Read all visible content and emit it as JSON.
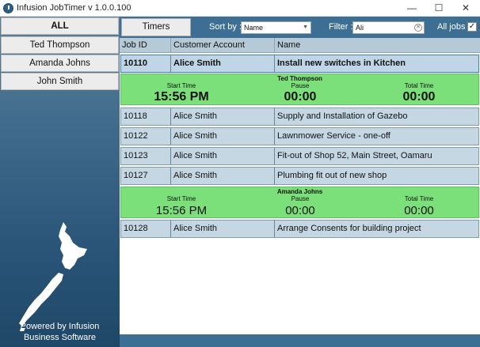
{
  "window": {
    "title": "Infusion JobTimer v 1.0.0.100",
    "controls": {
      "minimize": "—",
      "maximize": "☐",
      "close": "✕"
    }
  },
  "sidebar": {
    "items": [
      {
        "label": "ALL"
      },
      {
        "label": "Ted Thompson"
      },
      {
        "label": "Amanda Johns"
      },
      {
        "label": "John Smith"
      }
    ],
    "footer_line1": "Powered by Infusion",
    "footer_line2": "Business Software"
  },
  "toolbar": {
    "tab_label": "Timers",
    "sort_label": "Sort by :",
    "sort_value": "Name",
    "filter_label": "Filter :",
    "filter_value": "Ali",
    "all_jobs_label": "All jobs :",
    "all_jobs_checked": true
  },
  "grid": {
    "columns": [
      "Job ID",
      "Customer Account",
      "Name"
    ],
    "rows": [
      {
        "job_id": "10110",
        "customer": "Alice Smith",
        "name": "Install new switches in Kitchen"
      },
      {
        "job_id": "10118",
        "customer": "Alice Smith",
        "name": "Supply and Installation of Gazebo"
      },
      {
        "job_id": "10122",
        "customer": "Alice Smith",
        "name": "Lawnmower Service - one-off"
      },
      {
        "job_id": "10123",
        "customer": "Alice Smith",
        "name": "Fit-out of Shop 52, Main Street, Oamaru"
      },
      {
        "job_id": "10127",
        "customer": "Alice Smith",
        "name": "Plumbing fit out of new shop"
      },
      {
        "job_id": "10128",
        "customer": "Alice Smith",
        "name": "Arrange Consents for building project"
      }
    ],
    "timers": [
      {
        "person": "Ted Thompson",
        "start_label": "Start Time",
        "start_value": "15:56 PM",
        "pause_label": "Pause",
        "pause_value": "00:00",
        "total_label": "Total Time",
        "total_value": "00:00"
      },
      {
        "person": "Amanda Johns",
        "start_label": "Start Time",
        "start_value": "15:56 PM",
        "pause_label": "Pause",
        "pause_value": "00:00",
        "total_label": "Total Time",
        "total_value": "00:00"
      }
    ]
  },
  "colors": {
    "accent": "#3d6f95",
    "row_bg": "#c5d7e3",
    "timer_bg": "#7ce07a"
  },
  "icons": [
    "app-icon",
    "new-zealand-map-icon",
    "clear-filter-icon",
    "dropdown-caret-icon",
    "checkmark-icon"
  ]
}
